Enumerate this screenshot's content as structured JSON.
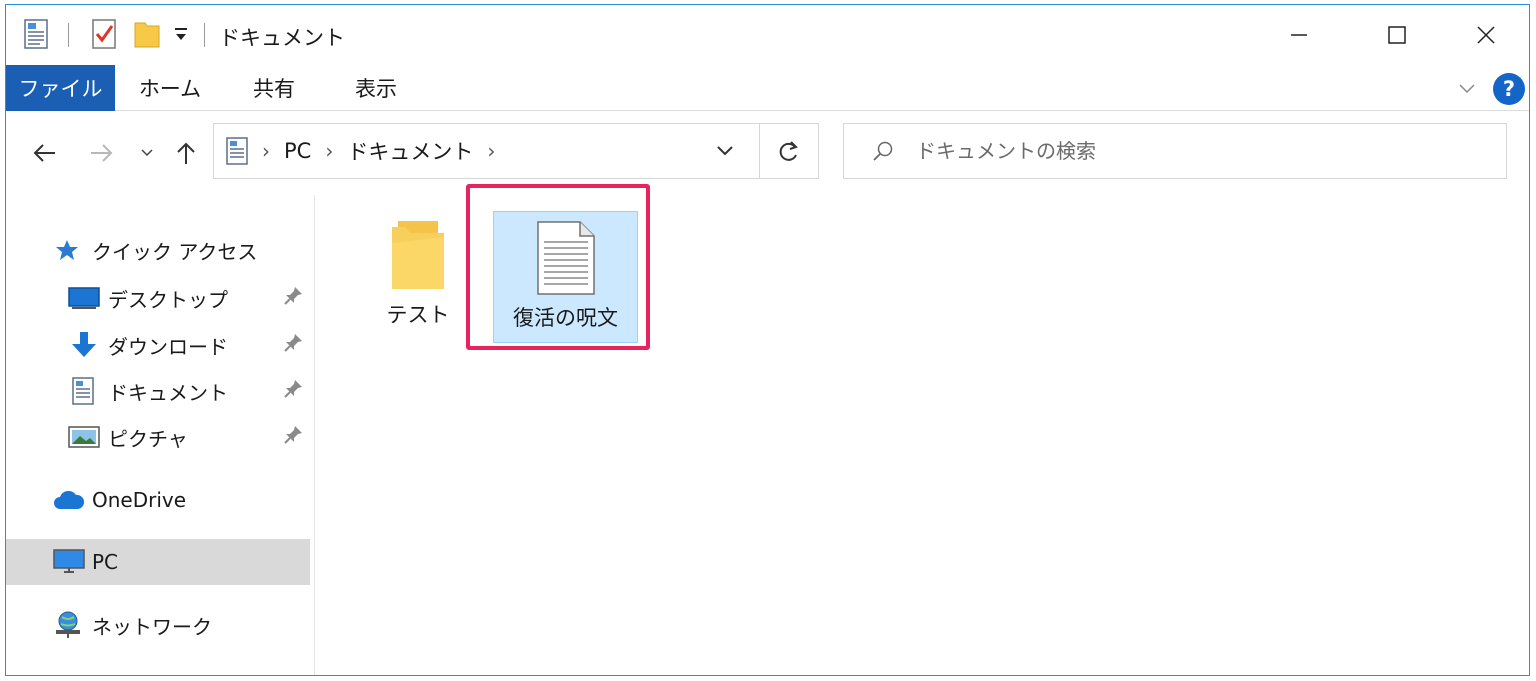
{
  "window": {
    "title": "ドキュメント",
    "quick_access_toolbar": [
      "document-icon",
      "properties-checkmark-icon",
      "new-folder-icon",
      "customize-toolbar-dropdown-icon"
    ],
    "controls": [
      "minimize-icon",
      "maximize-icon",
      "close-icon"
    ]
  },
  "ribbon": {
    "tabs": [
      {
        "label": "ファイル",
        "active": true
      },
      {
        "label": "ホーム"
      },
      {
        "label": "共有"
      },
      {
        "label": "表示"
      }
    ],
    "help_label": "?"
  },
  "address": {
    "breadcrumbs": [
      "PC",
      "ドキュメント"
    ],
    "search_placeholder": "ドキュメントの検索"
  },
  "nav_pane": {
    "quick_access": "クイック アクセス",
    "items": [
      {
        "label": "デスクトップ",
        "icon": "desktop-icon",
        "pinned": true
      },
      {
        "label": "ダウンロード",
        "icon": "download-arrow-icon",
        "pinned": true
      },
      {
        "label": "ドキュメント",
        "icon": "documents-icon",
        "pinned": true
      },
      {
        "label": "ピクチャ",
        "icon": "pictures-icon",
        "pinned": true
      }
    ],
    "onedrive": "OneDrive",
    "pc": "PC",
    "network": "ネットワーク",
    "selected": "PC"
  },
  "files": [
    {
      "name": "テスト",
      "type": "folder"
    },
    {
      "name": "復活の呪文",
      "type": "text-document",
      "selected": true
    }
  ],
  "colors": {
    "accent": "#1a5fb4",
    "window_border": "#2b8fd6",
    "selection": "#cce8ff",
    "highlight_box": "#e8245f",
    "folder_yellow": "#f7c948"
  }
}
